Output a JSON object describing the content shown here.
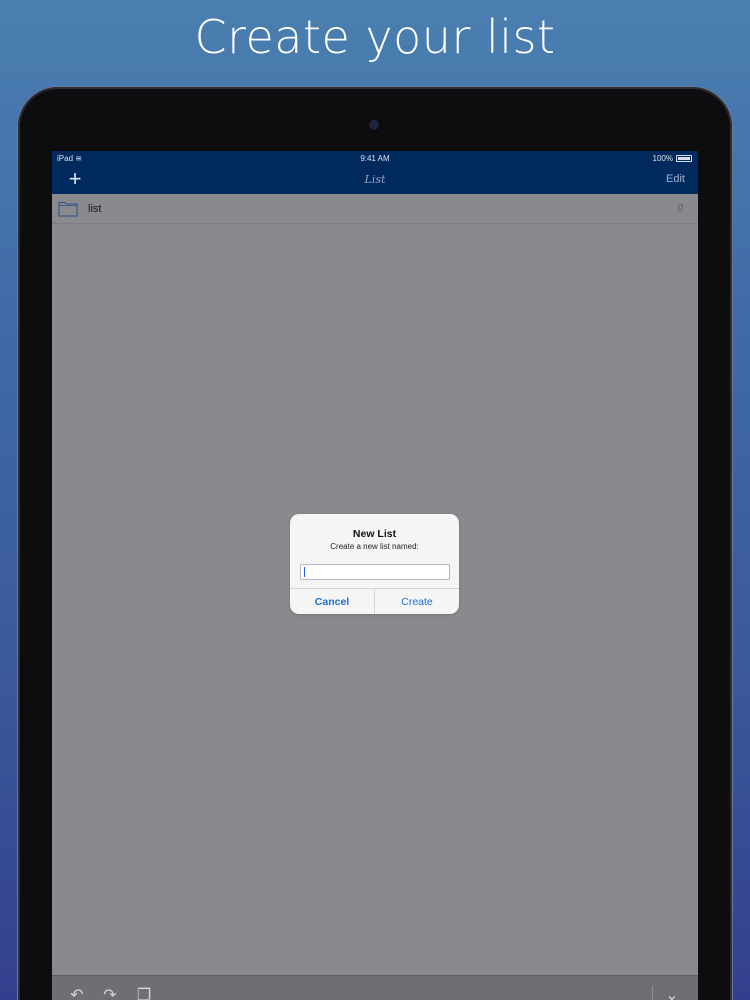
{
  "headline": "Create your list",
  "status_bar": {
    "device": "iPad",
    "time": "9:41 AM",
    "battery": "100%"
  },
  "nav_bar": {
    "title": "List",
    "add_label": "+",
    "edit_label": "Edit"
  },
  "list": {
    "items": [
      {
        "label": "list",
        "count": "0"
      }
    ]
  },
  "alert": {
    "title": "New List",
    "message": "Create a new list named:",
    "input_value": "",
    "cancel_label": "Cancel",
    "create_label": "Create"
  },
  "toolbar": {
    "icons": [
      "undo-icon",
      "redo-icon",
      "copy-icon",
      "chevron-down-icon"
    ]
  },
  "colors": {
    "nav_bar": "#002a5e",
    "alert_button": "#1a6fd8",
    "dimmed_screen": "#8a898d"
  }
}
